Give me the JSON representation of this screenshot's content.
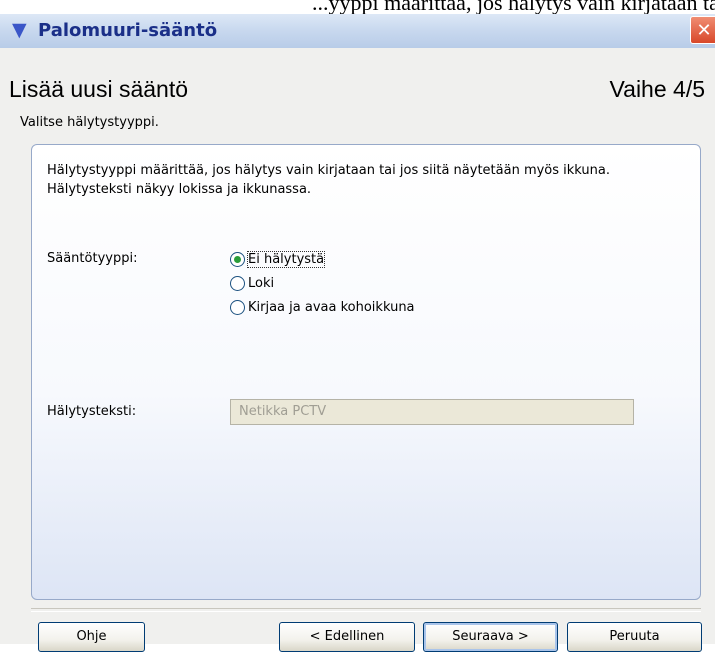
{
  "cropped_top_text": "...yyppi määrittää, jos hälytys vain kirjataan tai jos siitä näytetään",
  "window": {
    "title": "Palomuuri-sääntö",
    "close_glyph": "✕"
  },
  "header": {
    "title": "Lisää uusi sääntö",
    "step": "Vaihe 4/5",
    "subtitle": "Valitse hälytystyyppi."
  },
  "panel": {
    "description": "Hälytystyyppi määrittää, jos hälytys vain kirjataan tai jos siitä näytetään myös ikkuna. Hälytysteksti näkyy lokissa ja ikkunassa.",
    "rule_type_label": "Sääntötyyppi:",
    "options": [
      {
        "label": "Ei hälytystä",
        "selected": true
      },
      {
        "label": "Loki",
        "selected": false
      },
      {
        "label": "Kirjaa ja avaa kohoikkuna",
        "selected": false
      }
    ],
    "alert_text_label": "Hälytysteksti:",
    "alert_text_value": "Netikka PCTV"
  },
  "buttons": {
    "help": "Ohje",
    "back": "< Edellinen",
    "next": "Seuraava >",
    "cancel": "Peruuta"
  },
  "icons": {
    "title_icon": "firewall-shield-icon"
  }
}
